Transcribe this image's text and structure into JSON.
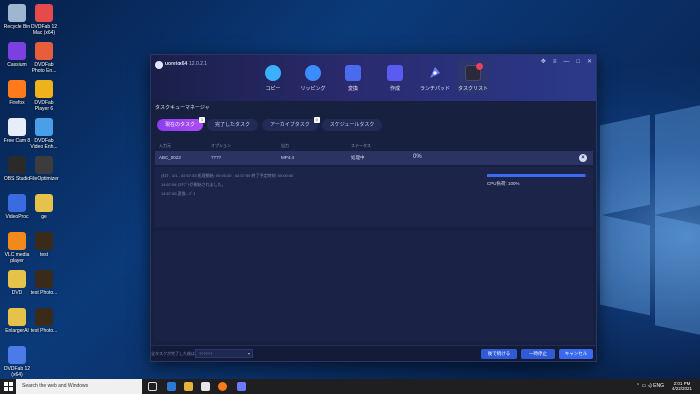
{
  "desktop": {
    "icons": [
      {
        "label": "Recycle Bin",
        "color": "#9fb6d1"
      },
      {
        "label": "DVDFab 12 Mac (x64)",
        "color": "#e64a4a"
      },
      {
        "label": "Cassium",
        "color": "#7c3fe0"
      },
      {
        "label": "DVDFab Photo En...",
        "color": "#e85d3a"
      },
      {
        "label": "Firefox",
        "color": "#ff7a1a"
      },
      {
        "label": "DVDFab Player 6",
        "color": "#f0b21a"
      },
      {
        "label": "Free Cam 8",
        "color": "#e8eef7"
      },
      {
        "label": "DVDFab Video Enh...",
        "color": "#4aa0e8"
      },
      {
        "label": "OBS Studio",
        "color": "#2a2a2a"
      },
      {
        "label": "FileOptimizer",
        "color": "#3c3c3c"
      },
      {
        "label": "VideoProc",
        "color": "#3a6be0"
      },
      {
        "label": "ge",
        "color": "#e6c24a"
      },
      {
        "label": "VLC media player",
        "color": "#f08a1a"
      },
      {
        "label": "test",
        "color": "#3a2a1a"
      },
      {
        "label": "DVD",
        "color": "#e6c24a"
      },
      {
        "label": "test Photo...",
        "color": "#3a2a1a"
      },
      {
        "label": "EnlargerAI",
        "color": "#e6c24a"
      },
      {
        "label": "test Photo...",
        "color": "#3a2a1a"
      },
      {
        "label": "DVDFab 12 (x64)",
        "color": "#4a7be8"
      }
    ]
  },
  "window": {
    "app_title": "uoreio",
    "app_title_suffix": "x64",
    "version": "12.0.2.1",
    "controls": [
      "✥",
      "≡",
      "—",
      "□",
      "✕"
    ],
    "nav": [
      {
        "label": "コピー",
        "icon": "copy-icon",
        "color": "#3bb0ff"
      },
      {
        "label": "リッピング",
        "icon": "ripper-icon",
        "color": "#3b8cff"
      },
      {
        "label": "変換",
        "icon": "converter-icon",
        "color": "#4a6bf0"
      },
      {
        "label": "作成",
        "icon": "creator-icon",
        "color": "#5a5bf0"
      },
      {
        "label": "ランチパッド",
        "icon": "launchpad-icon",
        "color": "#6a7bff"
      },
      {
        "label": "タスクリスト",
        "icon": "tasklist-icon",
        "color": "#2a2a3a"
      }
    ],
    "section_title": "タスクキューマネージャ",
    "subtabs": [
      {
        "label": "現在のタスク",
        "count": "1"
      },
      {
        "label": "完了したタスク",
        "count": ""
      },
      {
        "label": "アーカイブタスク",
        "count": "0"
      },
      {
        "label": "スケジュールタスク",
        "count": ""
      }
    ],
    "columns": [
      "入力元",
      "オプション",
      "出力",
      "ステータス"
    ],
    "task": {
      "source": "ABC_0023",
      "option": "????",
      "output": "MP4.4",
      "status": "処理中",
      "percent": "0%",
      "progress_fraction": 0.98,
      "cpu": "CPU負荷: 100%",
      "logs": [
        "(ﾀｽｸ - 1/1 - 02:57:53 処理開始: 00:00:30 , 02:57:59 終了予定時刻: 00:00:00",
        "14:57:54  ｽｸﾘﾌﾟﾄが開始されました。",
        "14:57:55  変換 - ﾊﾟｽ"
      ]
    },
    "footer": {
      "label": "全タスクが完了した後は:",
      "select_value": "??????",
      "buttons": [
        {
          "label": "後で続ける",
          "color": "#2f5bd6"
        },
        {
          "label": "一時停止",
          "color": "#2f5bd6"
        },
        {
          "label": "キャンセル",
          "color": "#3b6af0"
        }
      ]
    }
  },
  "taskbar": {
    "search_placeholder": "Search the web and Windows",
    "time": "2:01 PM",
    "date": "4/22/2021",
    "tray": "⌃ ▭ ◃) ENG"
  }
}
